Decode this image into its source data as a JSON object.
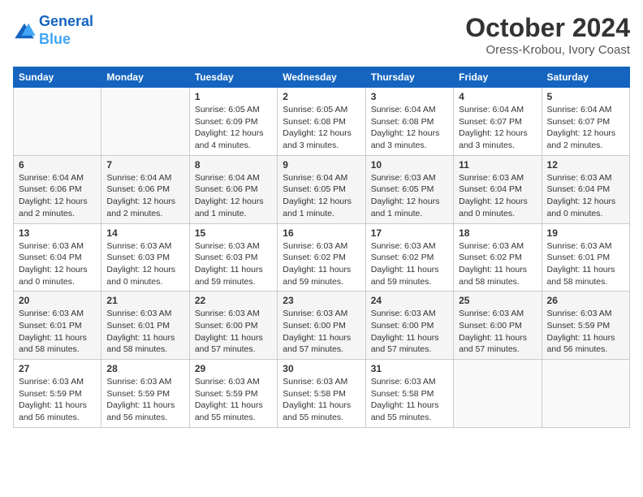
{
  "logo": {
    "line1": "General",
    "line2": "Blue"
  },
  "title": "October 2024",
  "location": "Oress-Krobou, Ivory Coast",
  "days_of_week": [
    "Sunday",
    "Monday",
    "Tuesday",
    "Wednesday",
    "Thursday",
    "Friday",
    "Saturday"
  ],
  "weeks": [
    [
      {
        "day": "",
        "info": ""
      },
      {
        "day": "",
        "info": ""
      },
      {
        "day": "1",
        "info": "Sunrise: 6:05 AM\nSunset: 6:09 PM\nDaylight: 12 hours and 4 minutes."
      },
      {
        "day": "2",
        "info": "Sunrise: 6:05 AM\nSunset: 6:08 PM\nDaylight: 12 hours and 3 minutes."
      },
      {
        "day": "3",
        "info": "Sunrise: 6:04 AM\nSunset: 6:08 PM\nDaylight: 12 hours and 3 minutes."
      },
      {
        "day": "4",
        "info": "Sunrise: 6:04 AM\nSunset: 6:07 PM\nDaylight: 12 hours and 3 minutes."
      },
      {
        "day": "5",
        "info": "Sunrise: 6:04 AM\nSunset: 6:07 PM\nDaylight: 12 hours and 2 minutes."
      }
    ],
    [
      {
        "day": "6",
        "info": "Sunrise: 6:04 AM\nSunset: 6:06 PM\nDaylight: 12 hours and 2 minutes."
      },
      {
        "day": "7",
        "info": "Sunrise: 6:04 AM\nSunset: 6:06 PM\nDaylight: 12 hours and 2 minutes."
      },
      {
        "day": "8",
        "info": "Sunrise: 6:04 AM\nSunset: 6:06 PM\nDaylight: 12 hours and 1 minute."
      },
      {
        "day": "9",
        "info": "Sunrise: 6:04 AM\nSunset: 6:05 PM\nDaylight: 12 hours and 1 minute."
      },
      {
        "day": "10",
        "info": "Sunrise: 6:03 AM\nSunset: 6:05 PM\nDaylight: 12 hours and 1 minute."
      },
      {
        "day": "11",
        "info": "Sunrise: 6:03 AM\nSunset: 6:04 PM\nDaylight: 12 hours and 0 minutes."
      },
      {
        "day": "12",
        "info": "Sunrise: 6:03 AM\nSunset: 6:04 PM\nDaylight: 12 hours and 0 minutes."
      }
    ],
    [
      {
        "day": "13",
        "info": "Sunrise: 6:03 AM\nSunset: 6:04 PM\nDaylight: 12 hours and 0 minutes."
      },
      {
        "day": "14",
        "info": "Sunrise: 6:03 AM\nSunset: 6:03 PM\nDaylight: 12 hours and 0 minutes."
      },
      {
        "day": "15",
        "info": "Sunrise: 6:03 AM\nSunset: 6:03 PM\nDaylight: 11 hours and 59 minutes."
      },
      {
        "day": "16",
        "info": "Sunrise: 6:03 AM\nSunset: 6:02 PM\nDaylight: 11 hours and 59 minutes."
      },
      {
        "day": "17",
        "info": "Sunrise: 6:03 AM\nSunset: 6:02 PM\nDaylight: 11 hours and 59 minutes."
      },
      {
        "day": "18",
        "info": "Sunrise: 6:03 AM\nSunset: 6:02 PM\nDaylight: 11 hours and 58 minutes."
      },
      {
        "day": "19",
        "info": "Sunrise: 6:03 AM\nSunset: 6:01 PM\nDaylight: 11 hours and 58 minutes."
      }
    ],
    [
      {
        "day": "20",
        "info": "Sunrise: 6:03 AM\nSunset: 6:01 PM\nDaylight: 11 hours and 58 minutes."
      },
      {
        "day": "21",
        "info": "Sunrise: 6:03 AM\nSunset: 6:01 PM\nDaylight: 11 hours and 58 minutes."
      },
      {
        "day": "22",
        "info": "Sunrise: 6:03 AM\nSunset: 6:00 PM\nDaylight: 11 hours and 57 minutes."
      },
      {
        "day": "23",
        "info": "Sunrise: 6:03 AM\nSunset: 6:00 PM\nDaylight: 11 hours and 57 minutes."
      },
      {
        "day": "24",
        "info": "Sunrise: 6:03 AM\nSunset: 6:00 PM\nDaylight: 11 hours and 57 minutes."
      },
      {
        "day": "25",
        "info": "Sunrise: 6:03 AM\nSunset: 6:00 PM\nDaylight: 11 hours and 57 minutes."
      },
      {
        "day": "26",
        "info": "Sunrise: 6:03 AM\nSunset: 5:59 PM\nDaylight: 11 hours and 56 minutes."
      }
    ],
    [
      {
        "day": "27",
        "info": "Sunrise: 6:03 AM\nSunset: 5:59 PM\nDaylight: 11 hours and 56 minutes."
      },
      {
        "day": "28",
        "info": "Sunrise: 6:03 AM\nSunset: 5:59 PM\nDaylight: 11 hours and 56 minutes."
      },
      {
        "day": "29",
        "info": "Sunrise: 6:03 AM\nSunset: 5:59 PM\nDaylight: 11 hours and 55 minutes."
      },
      {
        "day": "30",
        "info": "Sunrise: 6:03 AM\nSunset: 5:58 PM\nDaylight: 11 hours and 55 minutes."
      },
      {
        "day": "31",
        "info": "Sunrise: 6:03 AM\nSunset: 5:58 PM\nDaylight: 11 hours and 55 minutes."
      },
      {
        "day": "",
        "info": ""
      },
      {
        "day": "",
        "info": ""
      }
    ]
  ]
}
